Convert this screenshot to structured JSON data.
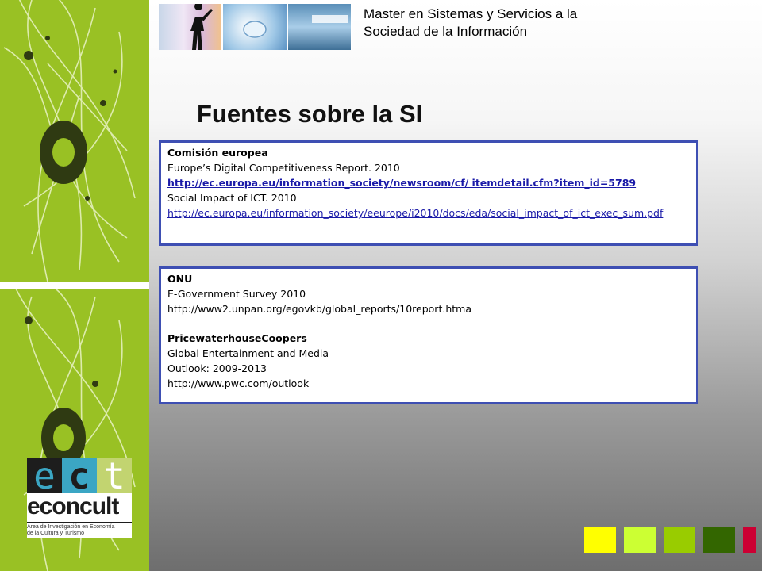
{
  "header": {
    "line1": "Master en Sistemas y Servicios a la",
    "line2": "Sociedad de la Información"
  },
  "title": "Fuentes sobre la SI",
  "box1": {
    "heading": "Comisión europea",
    "item1_title": "Europe’s Digital Competitiveness Report. 2010",
    "item1_link": "http://ec.europa.eu/information_society/newsroom/cf/ itemdetail.cfm?item_id=5789",
    "item2_title": "Social Impact of ICT. 2010",
    "item2_link": "http://ec.europa.eu/information_society/eeurope/i2010/docs/eda/social_impact_of_ict_exec_sum.pdf"
  },
  "box2": {
    "heading1": "ONU",
    "line1": "E-Government Survey 2010",
    "line2": "http://www2.unpan.org/egovkb/global_reports/10report.htma",
    "heading2": "PricewaterhouseCoopers",
    "line3": "Global Entertainment and Media",
    "line4": "Outlook: 2009-2013",
    "line5": "http://www.pwc.com/outlook"
  },
  "logo": {
    "letter1": "e",
    "letter2": "c",
    "letter3": "t",
    "word": "econcult",
    "sub1": "Àrea de Investigación en Economía",
    "sub2": "de la Cultura y Turismo"
  },
  "colors": {
    "sidebar_green": "#99c124",
    "box_border": "#3e4fb3",
    "squares": [
      "#ffff00",
      "#ccff33",
      "#99cc00",
      "#336600",
      "#cc0033"
    ]
  }
}
